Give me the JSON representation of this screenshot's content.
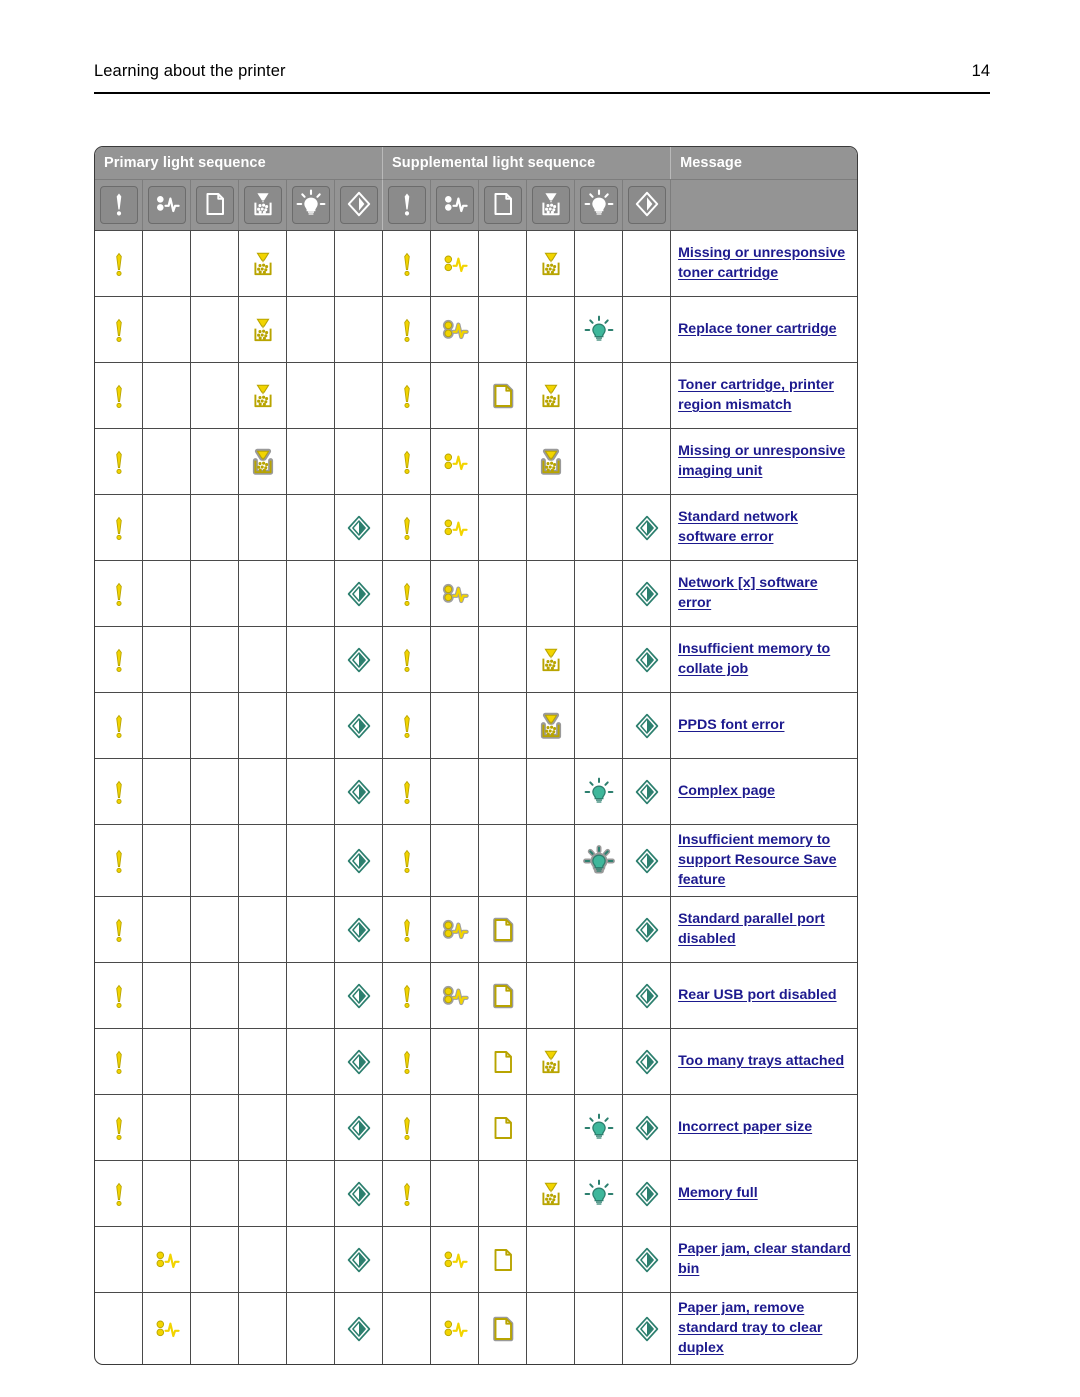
{
  "document": {
    "running_header": "Learning about the printer",
    "page_number": "14"
  },
  "table": {
    "group_headers": [
      {
        "label": "Primary light sequence",
        "span": 6
      },
      {
        "label": "Supplemental light sequence",
        "span": 6
      },
      {
        "label": "Message",
        "span": 1
      }
    ],
    "legend_icons": [
      "error-icon",
      "paper-jam-icon",
      "paper-icon",
      "toner-icon",
      "lightbulb-icon",
      "start-icon",
      "error-icon",
      "paper-jam-icon",
      "paper-icon",
      "toner-icon",
      "lightbulb-icon",
      "start-icon"
    ],
    "columns": [
      "primary-error",
      "primary-paper-jam",
      "primary-paper",
      "primary-toner",
      "primary-lightbulb",
      "primary-start",
      "supplemental-error",
      "supplemental-paper-jam",
      "supplemental-paper",
      "supplemental-toner",
      "supplemental-lightbulb",
      "supplemental-start",
      "message"
    ],
    "rows": [
      {
        "message": "Missing or unresponsive toner cartridge",
        "cells": [
          "error-on",
          null,
          null,
          "toner-on",
          null,
          null,
          "error-on",
          "jam-on",
          null,
          "toner-on",
          null,
          null
        ]
      },
      {
        "message": "Replace toner cartridge",
        "cells": [
          "error-on",
          null,
          null,
          "toner-on",
          null,
          null,
          "error-on",
          "jam-blink",
          null,
          null,
          "bulb-on",
          null
        ]
      },
      {
        "message": "Toner cartridge, printer region mismatch",
        "cells": [
          "error-on",
          null,
          null,
          "toner-on",
          null,
          null,
          "error-on",
          null,
          "paper-blink",
          "toner-on",
          null,
          null
        ]
      },
      {
        "message": "Missing or unresponsive imaging unit",
        "cells": [
          "error-on",
          null,
          null,
          "toner-blink",
          null,
          null,
          "error-on",
          "jam-on",
          null,
          "toner-blink",
          null,
          null
        ]
      },
      {
        "message": "Standard network software error",
        "cells": [
          "error-on",
          null,
          null,
          null,
          null,
          "start-on",
          "error-on",
          "jam-on",
          null,
          null,
          null,
          "start-on"
        ]
      },
      {
        "message": "Network [x] software error",
        "cells": [
          "error-on",
          null,
          null,
          null,
          null,
          "start-on",
          "error-on",
          "jam-blink",
          null,
          null,
          null,
          "start-on"
        ]
      },
      {
        "message": "Insufficient memory to collate job",
        "cells": [
          "error-on",
          null,
          null,
          null,
          null,
          "start-on",
          "error-on",
          null,
          null,
          "toner-on",
          null,
          "start-on"
        ]
      },
      {
        "message": "PPDS font error",
        "cells": [
          "error-on",
          null,
          null,
          null,
          null,
          "start-on",
          "error-on",
          null,
          null,
          "toner-blink",
          null,
          "start-on"
        ]
      },
      {
        "message": "Complex page",
        "cells": [
          "error-on",
          null,
          null,
          null,
          null,
          "start-on",
          "error-on",
          null,
          null,
          null,
          "bulb-on",
          "start-on"
        ]
      },
      {
        "message": "Insufficient memory to support Resource Save feature",
        "cells": [
          "error-on",
          null,
          null,
          null,
          null,
          "start-on",
          "error-on",
          null,
          null,
          null,
          "bulb-blink",
          "start-on"
        ]
      },
      {
        "message": "Standard parallel port disabled",
        "cells": [
          "error-on",
          null,
          null,
          null,
          null,
          "start-on",
          "error-on",
          "jam-blink",
          "paper-blink",
          null,
          null,
          "start-on"
        ]
      },
      {
        "message": "Rear USB port disabled",
        "cells": [
          "error-on",
          null,
          null,
          null,
          null,
          "start-on",
          "error-on",
          "jam-blink",
          "paper-blink",
          null,
          null,
          "start-on"
        ]
      },
      {
        "message": "Too many trays attached",
        "cells": [
          "error-on",
          null,
          null,
          null,
          null,
          "start-on",
          "error-on",
          null,
          "paper-on",
          "toner-on",
          null,
          "start-on"
        ]
      },
      {
        "message": "Incorrect paper size",
        "cells": [
          "error-on",
          null,
          null,
          null,
          null,
          "start-on",
          "error-on",
          null,
          "paper-on",
          null,
          "bulb-on",
          "start-on"
        ]
      },
      {
        "message": "Memory full",
        "cells": [
          "error-on",
          null,
          null,
          null,
          null,
          "start-on",
          "error-on",
          null,
          null,
          "toner-on",
          "bulb-on",
          "start-on"
        ]
      },
      {
        "message": "Paper jam, clear standard bin",
        "cells": [
          null,
          "jam-on",
          null,
          null,
          null,
          "start-on",
          null,
          "jam-on",
          "paper-on",
          null,
          null,
          "start-on"
        ]
      },
      {
        "message": "Paper jam, remove standard tray to clear duplex",
        "cells": [
          null,
          "jam-on",
          null,
          null,
          null,
          "start-on",
          null,
          "jam-on",
          "paper-blink",
          null,
          null,
          "start-on"
        ]
      }
    ]
  },
  "colors": {
    "header_band": "#949494",
    "message_link": "#1d1a8e",
    "light_on_yellow": "#F2D400",
    "light_green": "#3FB79B",
    "blink_halo": "#9a9a9a",
    "page_background": "#ffffff"
  }
}
